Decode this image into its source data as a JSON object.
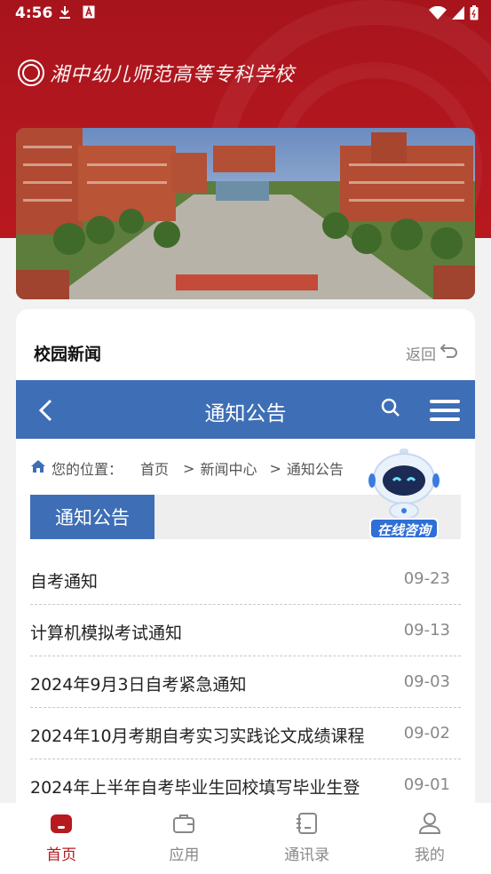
{
  "status_bar": {
    "time": "4:56"
  },
  "header": {
    "school_name": "湘中幼儿师范高等专科学校"
  },
  "card": {
    "title": "校园新闻",
    "back_label": "返回"
  },
  "site_nav": {
    "title": "通知公告"
  },
  "breadcrumb": {
    "prefix": "您的位置：",
    "items": [
      "首页",
      "新闻中心",
      "通知公告"
    ],
    "separator": ">"
  },
  "section": {
    "tab_label": "通知公告"
  },
  "news": [
    {
      "title": "自考通知",
      "date": "09-23"
    },
    {
      "title": "计算机模拟考试通知",
      "date": "09-13"
    },
    {
      "title": "2024年9月3日自考紧急通知",
      "date": "09-03"
    },
    {
      "title": "2024年10月考期自考实习实践论文成绩课程",
      "date": "09-02"
    },
    {
      "title": "2024年上半年自考毕业生回校填写毕业生登",
      "date": "09-01"
    }
  ],
  "robot": {
    "label": "在线咨询"
  },
  "tabbar": [
    {
      "label": "首页",
      "icon": "home-icon",
      "active": true
    },
    {
      "label": "应用",
      "icon": "briefcase-icon",
      "active": false
    },
    {
      "label": "通讯录",
      "icon": "contacts-icon",
      "active": false
    },
    {
      "label": "我的",
      "icon": "user-icon",
      "active": false
    }
  ],
  "colors": {
    "brand_red": "#b8191f",
    "nav_blue": "#3d6eb6",
    "robot_blue": "#2f6fd6"
  }
}
